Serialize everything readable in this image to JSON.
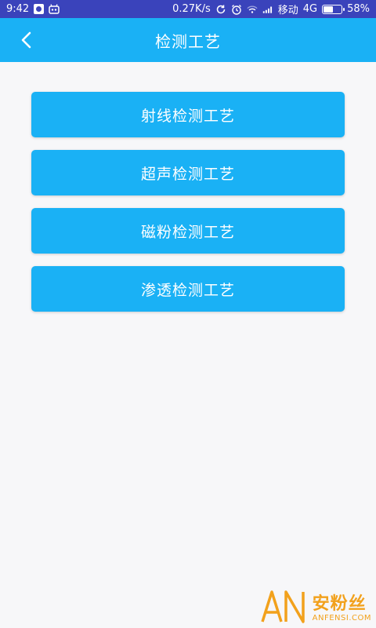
{
  "status_bar": {
    "time": "9:42",
    "network_speed": "0.27K/s",
    "carrier": "移动",
    "network_type": "4G",
    "battery": "58%",
    "battery_level": 0.58,
    "icons": [
      "shield-app-icon",
      "robot-app-icon",
      "sync-icon",
      "alarm-icon",
      "wifi-icon",
      "signal-icon",
      "battery-icon"
    ],
    "background_color": "#3a43bb"
  },
  "app_bar": {
    "title": "检测工艺",
    "back_icon": "chevron-left-icon",
    "background_color": "#1ab1f5"
  },
  "menu": {
    "items": [
      {
        "label": "射线检测工艺"
      },
      {
        "label": "超声检测工艺"
      },
      {
        "label": "磁粉检测工艺"
      },
      {
        "label": "渗透检测工艺"
      }
    ],
    "button_color": "#1ab1f5"
  },
  "watermark": {
    "logo_text": "AN",
    "text_cn": "安粉丝",
    "text_en": "ANFENSI.COM",
    "color": "#f2a11c"
  }
}
